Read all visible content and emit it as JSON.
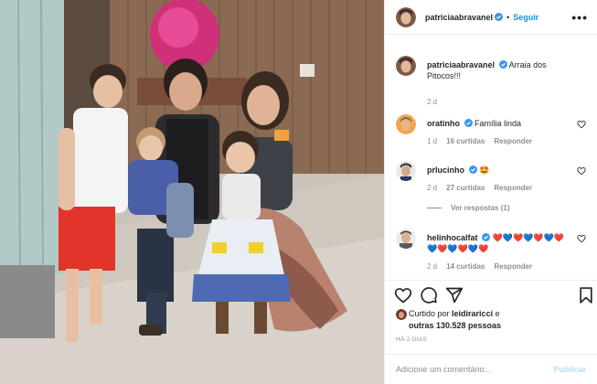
{
  "post": {
    "author": "patriciaabravanel",
    "verified": true,
    "separator": "•",
    "follow_label": "Seguir",
    "more_icon": "more-options-icon",
    "caption_text": "Arraia dos Pitocos!!!",
    "caption_age": "2 d"
  },
  "comments": [
    {
      "user": "oratinho",
      "verified": true,
      "text": "Família linda",
      "age": "1 d",
      "likes": "16 curtidas",
      "reply_label": "Responder"
    },
    {
      "user": "prlucinho",
      "verified": true,
      "text": "🤩",
      "age": "2 d",
      "likes": "27 curtidas",
      "reply_label": "Responder",
      "view_replies": "Ver respostas (1)"
    },
    {
      "user": "helinhocalfat",
      "verified": true,
      "text": "❤️💙❤️💙❤️💙❤️💙❤️💙❤️💙❤️",
      "age": "2 d",
      "likes": "14 curtidas",
      "reply_label": "Responder"
    }
  ],
  "actions": [
    "heart-icon",
    "comment-icon",
    "share-icon",
    "bookmark-icon"
  ],
  "liked_by": {
    "prefix": "Curtido por",
    "user": "leidiraricci",
    "and": "e",
    "others": "outras 130.528 pessoas"
  },
  "timestamp": "HÁ 2 DIAS",
  "add_comment": {
    "placeholder": "Adicione um comentário...",
    "publish_label": "Publicar"
  },
  "colors": {
    "accent": "#0095f6",
    "publish_disabled": "#b2dffc",
    "verified_badge": "#3897f0",
    "secondary_text": "#8e8e8e"
  }
}
